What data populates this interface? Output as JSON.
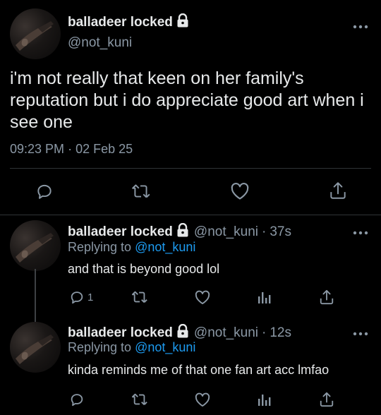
{
  "main_tweet": {
    "display_name": "balladeer locked",
    "handle": "@not_kuni",
    "text": "i'm not really that keen on her family's reputation but i do appreciate good art when i see one",
    "time": "09:23 PM",
    "separator": "·",
    "date": "02 Feb 25"
  },
  "replies": [
    {
      "display_name": "balladeer locked",
      "handle": "@not_kuni",
      "separator": "·",
      "age": "37s",
      "replying_prefix": "Replying to",
      "replying_to": "@not_kuni",
      "text": "and that is beyond good lol",
      "reply_count": "1"
    },
    {
      "display_name": "balladeer locked",
      "handle": "@not_kuni",
      "separator": "·",
      "age": "12s",
      "replying_prefix": "Replying to",
      "replying_to": "@not_kuni",
      "text": "kinda reminds me of that one fan art acc lmfao",
      "reply_count": ""
    }
  ],
  "icons": {
    "more": "more-icon",
    "reply": "reply-icon",
    "retweet": "retweet-icon",
    "like": "like-icon",
    "share": "share-icon",
    "analytics": "analytics-icon",
    "lock": "lock-icon"
  },
  "colors": {
    "background": "#000000",
    "text": "#e7e9ea",
    "secondary": "#8b98a5",
    "link": "#1d9bf0",
    "divider": "#2f3336"
  }
}
